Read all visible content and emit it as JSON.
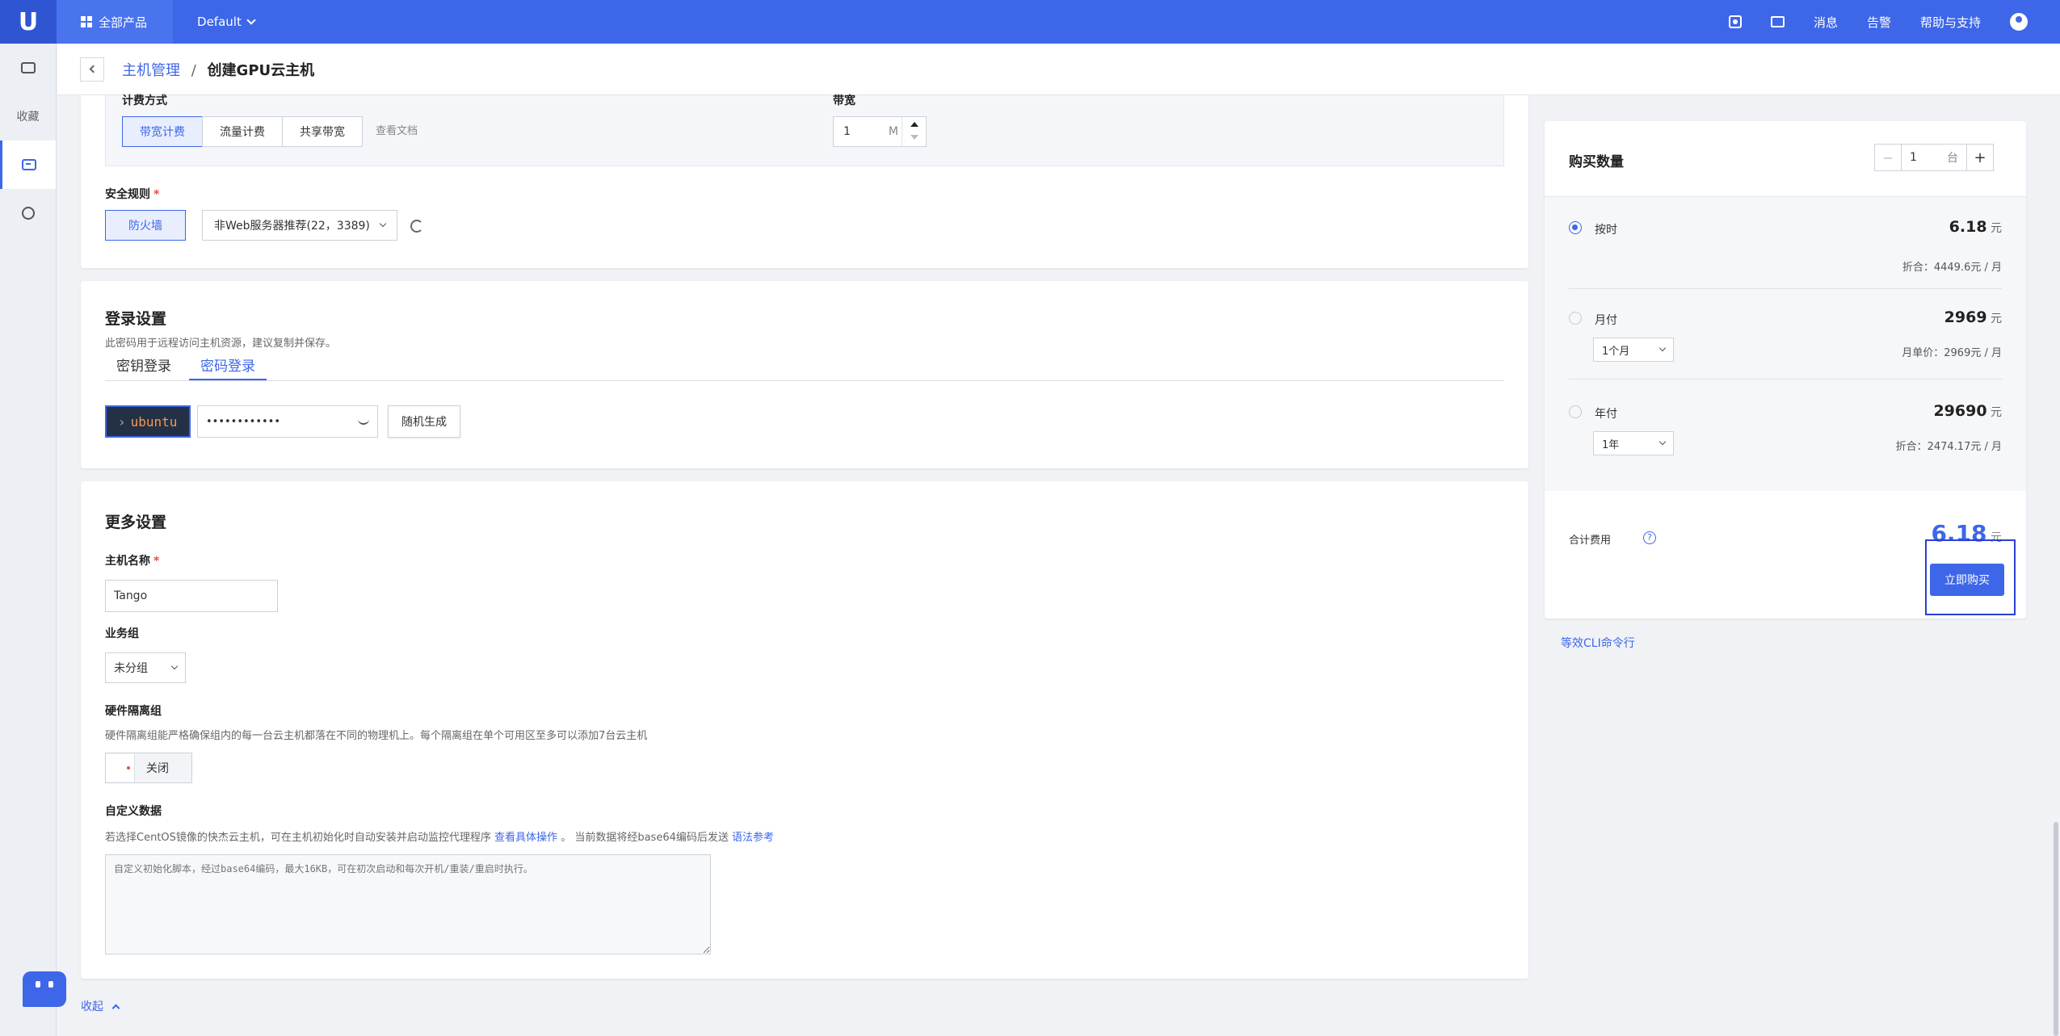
{
  "topbar": {
    "logo": "U",
    "all_products": "全部产品",
    "project": "Default",
    "messages": "消息",
    "alerts": "告警",
    "help": "帮助与支持"
  },
  "sidebar": {
    "favorites": "收藏"
  },
  "breadcrumb": {
    "parent": "主机管理",
    "separator": "/",
    "current": "创建GPU云主机"
  },
  "billing": {
    "label": "计费方式",
    "options": [
      "带宽计费",
      "流量计费",
      "共享带宽"
    ],
    "doc_link": "查看文档",
    "bandwidth_label": "带宽",
    "bandwidth_value": "1",
    "bandwidth_unit": "M"
  },
  "security": {
    "label": "安全规则",
    "firewall_button": "防火墙",
    "rule_value": "非Web服务器推荐(22，3389)"
  },
  "login": {
    "title": "登录设置",
    "desc": "此密码用于远程访问主机资源，建议复制并保存。",
    "tabs": [
      "密钥登录",
      "密码登录"
    ],
    "username": "ubuntu",
    "password_mask": "••••••••••••",
    "random_button": "随机生成"
  },
  "more": {
    "title": "更多设置",
    "hostname_label": "主机名称",
    "hostname_value": "Tango",
    "group_label": "业务组",
    "group_value": "未分组",
    "isolation_label": "硬件隔离组",
    "isolation_desc": "硬件隔离组能严格确保组内的每一台云主机都落在不同的物理机上。每个隔离组在单个可用区至多可以添加7台云主机",
    "isolation_toggle": "关闭",
    "userdata_label": "自定义数据",
    "userdata_desc_1": "若选择CentOS镜像的快杰云主机，可在主机初始化时自动安装并启动监控代理程序",
    "userdata_link_1": "查看具体操作",
    "userdata_desc_2": "。 当前数据将经base64编码后发送",
    "userdata_link_2": "语法参考",
    "userdata_placeholder": "自定义初始化脚本，经过base64编码，最大16KB，可在初次启动和每次开机/重装/重启时执行。"
  },
  "collapse_label": "收起",
  "purchase": {
    "quantity_label": "购买数量",
    "quantity_value": "1",
    "quantity_unit": "台",
    "minus": "−",
    "plus": "+",
    "plans": [
      {
        "name": "按时",
        "price": "6.18",
        "unit": "元",
        "note": "折合：4449.6元 / 月",
        "selected": true
      },
      {
        "name": "月付",
        "price": "2969",
        "unit": "元",
        "note": "月单价：2969元 / 月",
        "period": "1个月",
        "selected": false
      },
      {
        "name": "年付",
        "price": "29690",
        "unit": "元",
        "note": "折合：2474.17元 / 月",
        "period": "1年",
        "selected": false
      }
    ],
    "total_label": "合计费用",
    "total_value": "6.18",
    "total_unit": "元",
    "buy_button": "立即购买",
    "cli_link": "等效CLI命令行"
  },
  "colors": {
    "primary": "#3d66e8",
    "topbar": "#3d66e8",
    "background": "#f0f2f6",
    "required": "#e84c4c"
  }
}
